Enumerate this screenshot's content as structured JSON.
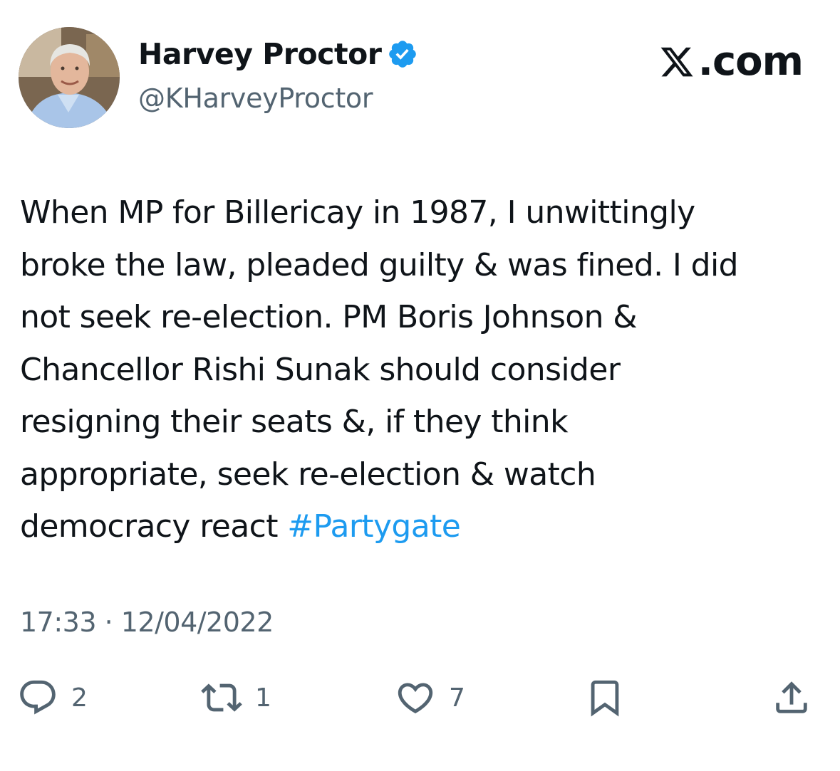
{
  "author": {
    "display_name": "Harvey Proctor",
    "handle": "@KHarveyProctor"
  },
  "brand": {
    "label": ".com"
  },
  "tweet": {
    "text": "When MP for Billericay in 1987, I unwittingly\nbroke the law, pleaded guilty & was fined. I did\nnot seek re-election. PM Boris Johnson &\nChancellor Rishi Sunak should consider\nresigning their seats &, if they think\nappropriate, seek re-election & watch\ndemocracy react ",
    "hashtag": "#Partygate",
    "timestamp": "17:33 · 12/04/2022"
  },
  "actions": {
    "replies": "2",
    "retweets": "1",
    "likes": "7"
  },
  "icons": {
    "verified": "verified-badge-icon",
    "brand": "x-logo-icon",
    "reply": "reply-icon",
    "retweet": "retweet-icon",
    "like": "heart-icon",
    "bookmark": "bookmark-icon",
    "share": "share-icon"
  },
  "colors": {
    "text": "#0f1419",
    "secondary": "#536471",
    "hashtag": "#1d9bf0",
    "verified": "#1d9bf0"
  }
}
